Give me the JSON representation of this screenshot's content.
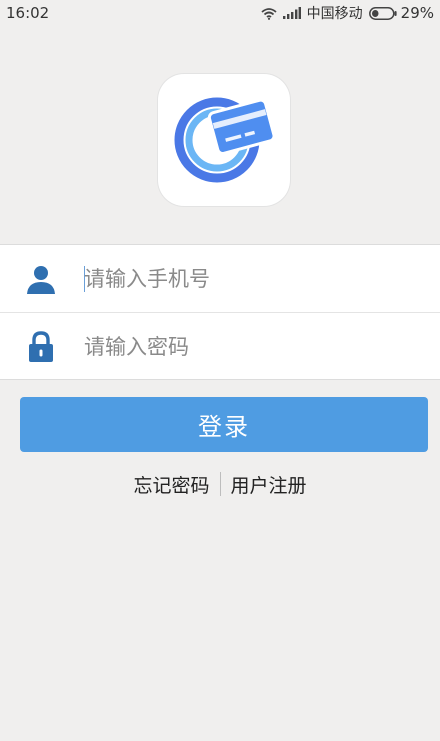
{
  "status_bar": {
    "time": "16:02",
    "wifi_icon": "wifi-icon",
    "signal_icon": "cell-signal-icon",
    "carrier": "中国移动",
    "battery_icon": "battery-icon",
    "battery_percent": "29%"
  },
  "app_logo": {
    "icon": "card-payment-logo-icon",
    "colors": {
      "ring_outer": "#4a78e6",
      "ring_inner": "#6bb6f5",
      "card": "#4f8ef0"
    }
  },
  "login_form": {
    "phone": {
      "icon": "user-icon",
      "placeholder": "请输入手机号",
      "value": ""
    },
    "password": {
      "icon": "lock-icon",
      "placeholder": "请输入密码",
      "value": ""
    },
    "submit_label": "登录"
  },
  "links": {
    "forgot_password": "忘记密码",
    "register": "用户注册"
  },
  "colors": {
    "accent": "#4f9ce2",
    "icon": "#2f6fb0",
    "background": "#f0efee"
  }
}
